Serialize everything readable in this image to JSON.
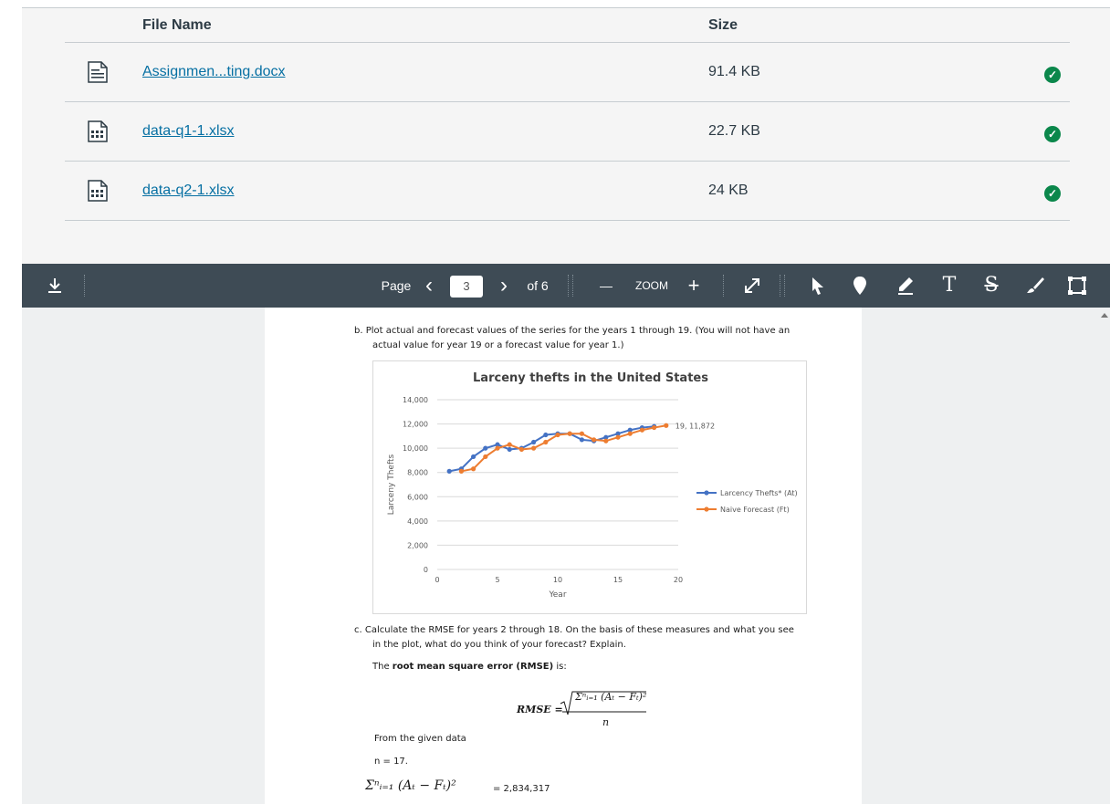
{
  "files": {
    "headers": {
      "name": "File Name",
      "size": "Size"
    },
    "rows": [
      {
        "name": "Assignmen...ting.docx",
        "size": "91.4 KB",
        "icon": "document-icon"
      },
      {
        "name": "data-q1-1.xlsx",
        "size": "22.7 KB",
        "icon": "spreadsheet-icon"
      },
      {
        "name": "data-q2-1.xlsx",
        "size": "24 KB",
        "icon": "spreadsheet-icon"
      }
    ],
    "check_glyph": "✓"
  },
  "toolbar": {
    "page_label": "Page",
    "page_value": "3",
    "of_label": "of 6",
    "zoom_label": "ZOOM",
    "prev": "‹",
    "next": "›",
    "minus": "—",
    "plus": "+",
    "text_tool": "T",
    "strike_tool": "S"
  },
  "doc": {
    "b_line1": "b.   Plot actual and forecast values of the series for the years 1 through 19. (You will not have an",
    "b_line2": "actual value for year 19 or a forecast value for year 1.)",
    "c_line1": "c.   Calculate the RMSE for years 2 through 18. On the basis of these measures and what you see",
    "c_line2": "in the plot, what do you think of your forecast? Explain.",
    "rmse_intro_pre": "The ",
    "rmse_intro_bold": "root mean square error (RMSE)",
    "rmse_intro_post": " is:",
    "formula_lhs": "RMSE =",
    "formula_num": "Σⁿᵢ₌₁ (Aₜ − Fₜ)²",
    "formula_den": "n",
    "from_data": "From the given data",
    "n_value": "n = 17.",
    "sum_expr": "Σⁿᵢ₌₁ (Aₜ − Fₜ)²",
    "sum_value": "= 2,834,317"
  },
  "chart_data": {
    "type": "line",
    "title": "Larceny thefts in the United States",
    "xlabel": "Year",
    "ylabel": "Larceny Thefts",
    "xlim": [
      0,
      20
    ],
    "ylim": [
      0,
      14000
    ],
    "x_ticks": [
      0,
      5,
      10,
      15,
      20
    ],
    "y_ticks": [
      0,
      2000,
      4000,
      6000,
      8000,
      10000,
      12000,
      14000
    ],
    "y_tick_labels": [
      "0",
      "2,000",
      "4,000",
      "6,000",
      "8,000",
      "10,000",
      "12,000",
      "14,000"
    ],
    "x_tick_labels": [
      "0",
      "5",
      "10",
      "15",
      "20"
    ],
    "grid": true,
    "legend_position": "right",
    "series": [
      {
        "name": "Larcency Thefts* (At)",
        "color": "#4472c4",
        "x": [
          1,
          2,
          3,
          4,
          5,
          6,
          7,
          8,
          9,
          10,
          11,
          12,
          13,
          14,
          15,
          16,
          17,
          18
        ],
        "y": [
          8100,
          8300,
          9300,
          10000,
          10300,
          9900,
          10000,
          10500,
          11100,
          11200,
          11200,
          10700,
          10600,
          10900,
          11200,
          11500,
          11700,
          11800
        ]
      },
      {
        "name": "Naive Forecast (Ft)",
        "color": "#ed7d31",
        "x": [
          2,
          3,
          4,
          5,
          6,
          7,
          8,
          9,
          10,
          11,
          12,
          13,
          14,
          15,
          16,
          17,
          18,
          19
        ],
        "y": [
          8100,
          8300,
          9300,
          10000,
          10300,
          9900,
          10000,
          10500,
          11100,
          11200,
          11200,
          10700,
          10600,
          10900,
          11200,
          11500,
          11700,
          11872
        ]
      }
    ],
    "annotation": "19, 11,872"
  }
}
